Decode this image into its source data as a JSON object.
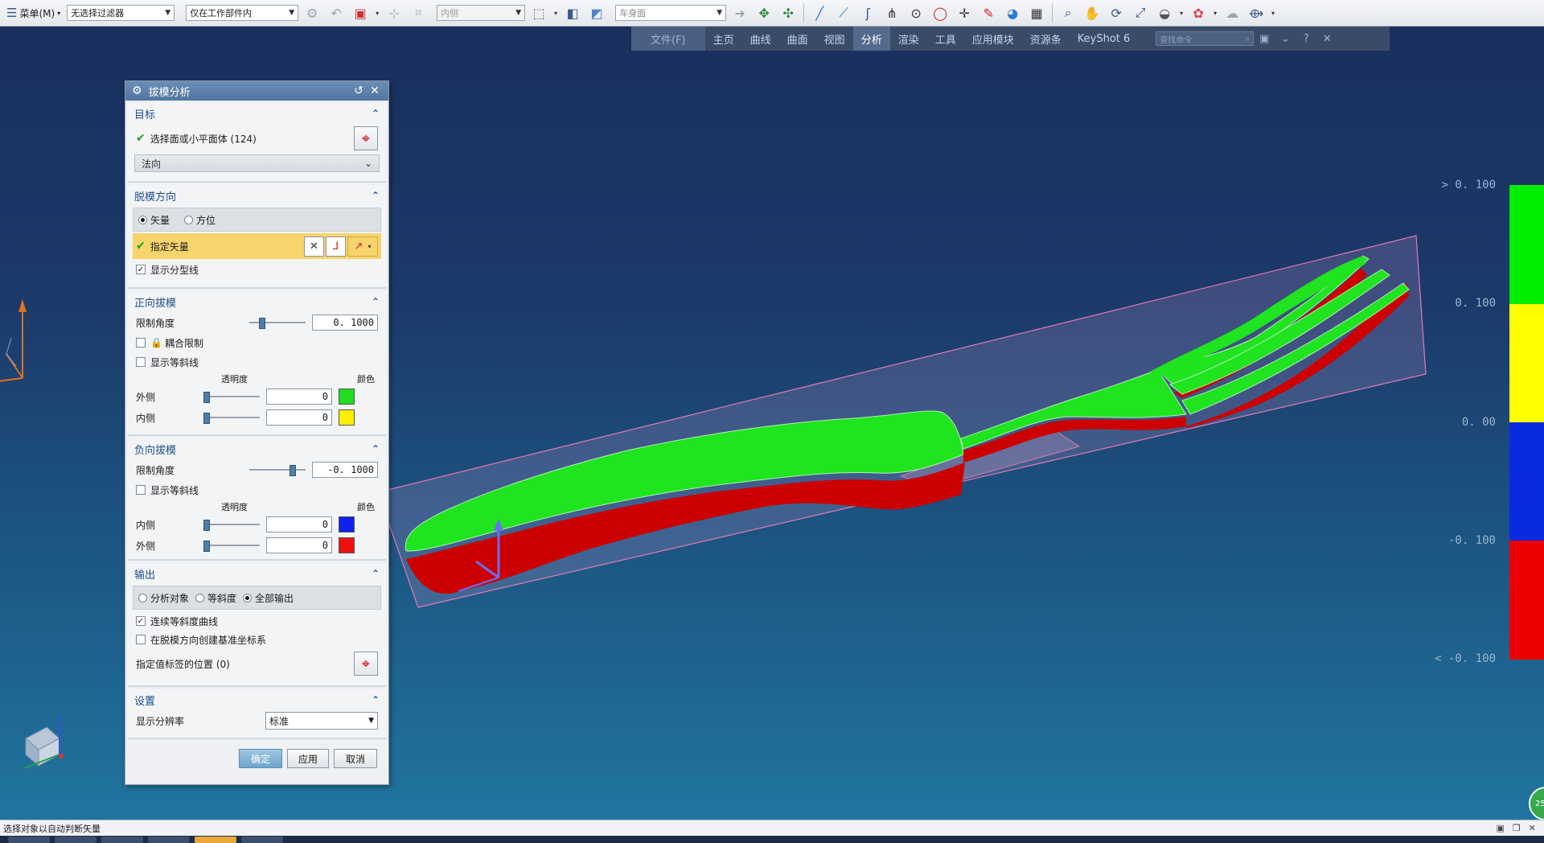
{
  "toolbar": {
    "menu_label": "菜单(M)",
    "filter_select": "无选择过滤器",
    "scope_select": "仅在工作部件内",
    "snap_select": "内侧",
    "face_select": "车身面"
  },
  "ribbon": {
    "tabs": [
      "文件(F)",
      "主页",
      "曲线",
      "曲面",
      "视图",
      "分析",
      "渲染",
      "工具",
      "应用模块",
      "资源条",
      "KeyShot 6"
    ],
    "active_tab": "分析",
    "search_placeholder": "查找命令"
  },
  "dialog": {
    "title": "拔模分析",
    "target": {
      "heading": "目标",
      "select_label": "选择面或小平面体 (124)",
      "normal_combo": "法向"
    },
    "draft_direction": {
      "heading": "脱模方向",
      "radio_vector": "矢量",
      "radio_orient": "方位",
      "specify_vector": "指定矢量",
      "show_parting_line": "显示分型线"
    },
    "positive_draft": {
      "heading": "正向拔模",
      "limit_angle_label": "限制角度",
      "limit_angle_value": "0. 1000",
      "limit_angle_slider": 0.2,
      "coupled_limit": "耦合限制",
      "show_isoclines": "显示等斜线",
      "transparency_header": "透明度",
      "color_header": "颜色",
      "outside_label": "外侧",
      "outside_value": "0",
      "inside_label": "内侧",
      "inside_value": "0",
      "outside_color": "#22dd22",
      "inside_color": "#ffee00"
    },
    "negative_draft": {
      "heading": "负向拔模",
      "limit_angle_label": "限制角度",
      "limit_angle_value": "-0. 1000",
      "limit_angle_slider": 0.8,
      "show_isoclines": "显示等斜线",
      "transparency_header": "透明度",
      "color_header": "颜色",
      "inside_label": "内侧",
      "inside_value": "0",
      "outside_label": "外侧",
      "outside_value": "0",
      "inside_color": "#1020ee",
      "outside_color": "#ee1010"
    },
    "output": {
      "heading": "输出",
      "radio_analysis_object": "分析对象",
      "radio_isocline": "等斜度",
      "radio_all_output": "全部输出",
      "continuous_isocline": "连续等斜度曲线",
      "create_csys": "在脱模方向创建基准坐标系",
      "label_position": "指定值标签的位置 (0)"
    },
    "settings": {
      "heading": "设置",
      "resolution_label": "显示分辨率",
      "resolution_value": "标准"
    },
    "buttons": {
      "ok": "确定",
      "apply": "应用",
      "cancel": "取消"
    }
  },
  "legend": {
    "labels": [
      "> 0. 100",
      "0. 100",
      "0. 00",
      "-0. 100",
      "< -0. 100"
    ],
    "colors": [
      "#00ee00",
      "#ffff00",
      "#0a2ae0",
      "#ee0000"
    ]
  },
  "status": {
    "prompt": "选择对象以自动判断矢量",
    "badge": "25"
  }
}
